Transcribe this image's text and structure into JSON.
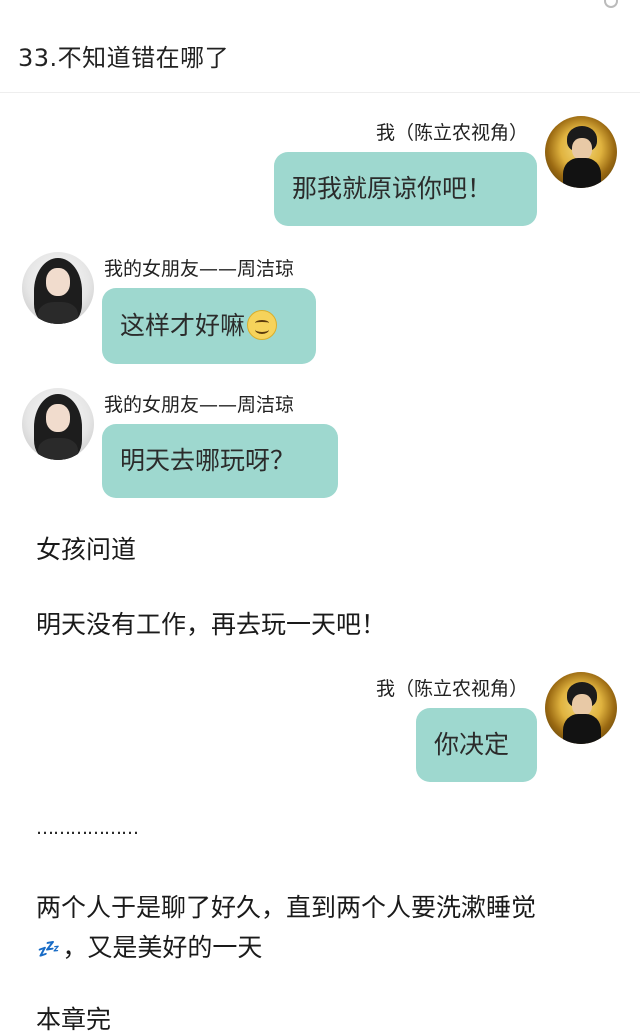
{
  "header": {
    "title": "33.不知道错在哪了"
  },
  "names": {
    "me": "我（陈立农视角）",
    "gf": "我的女朋友——周洁琼"
  },
  "messages": [
    {
      "sender": "me",
      "text": "那我就原谅你吧！"
    },
    {
      "sender": "gf",
      "text": "这样才好嘛",
      "emoji": "smiling-face-icon"
    },
    {
      "sender": "gf",
      "text": "明天去哪玩呀？"
    },
    {
      "sender": "me",
      "text": "你决定"
    }
  ],
  "narration": {
    "p1": "女孩问道",
    "p2": "明天没有工作，再去玩一天吧！",
    "dots": "………………",
    "p3_line1": "两个人于是聊了好久，直到两个人要洗漱睡觉",
    "p3_line2_emoji": "💤",
    "p3_line2": "，又是美好的一天",
    "end": "本章完"
  }
}
